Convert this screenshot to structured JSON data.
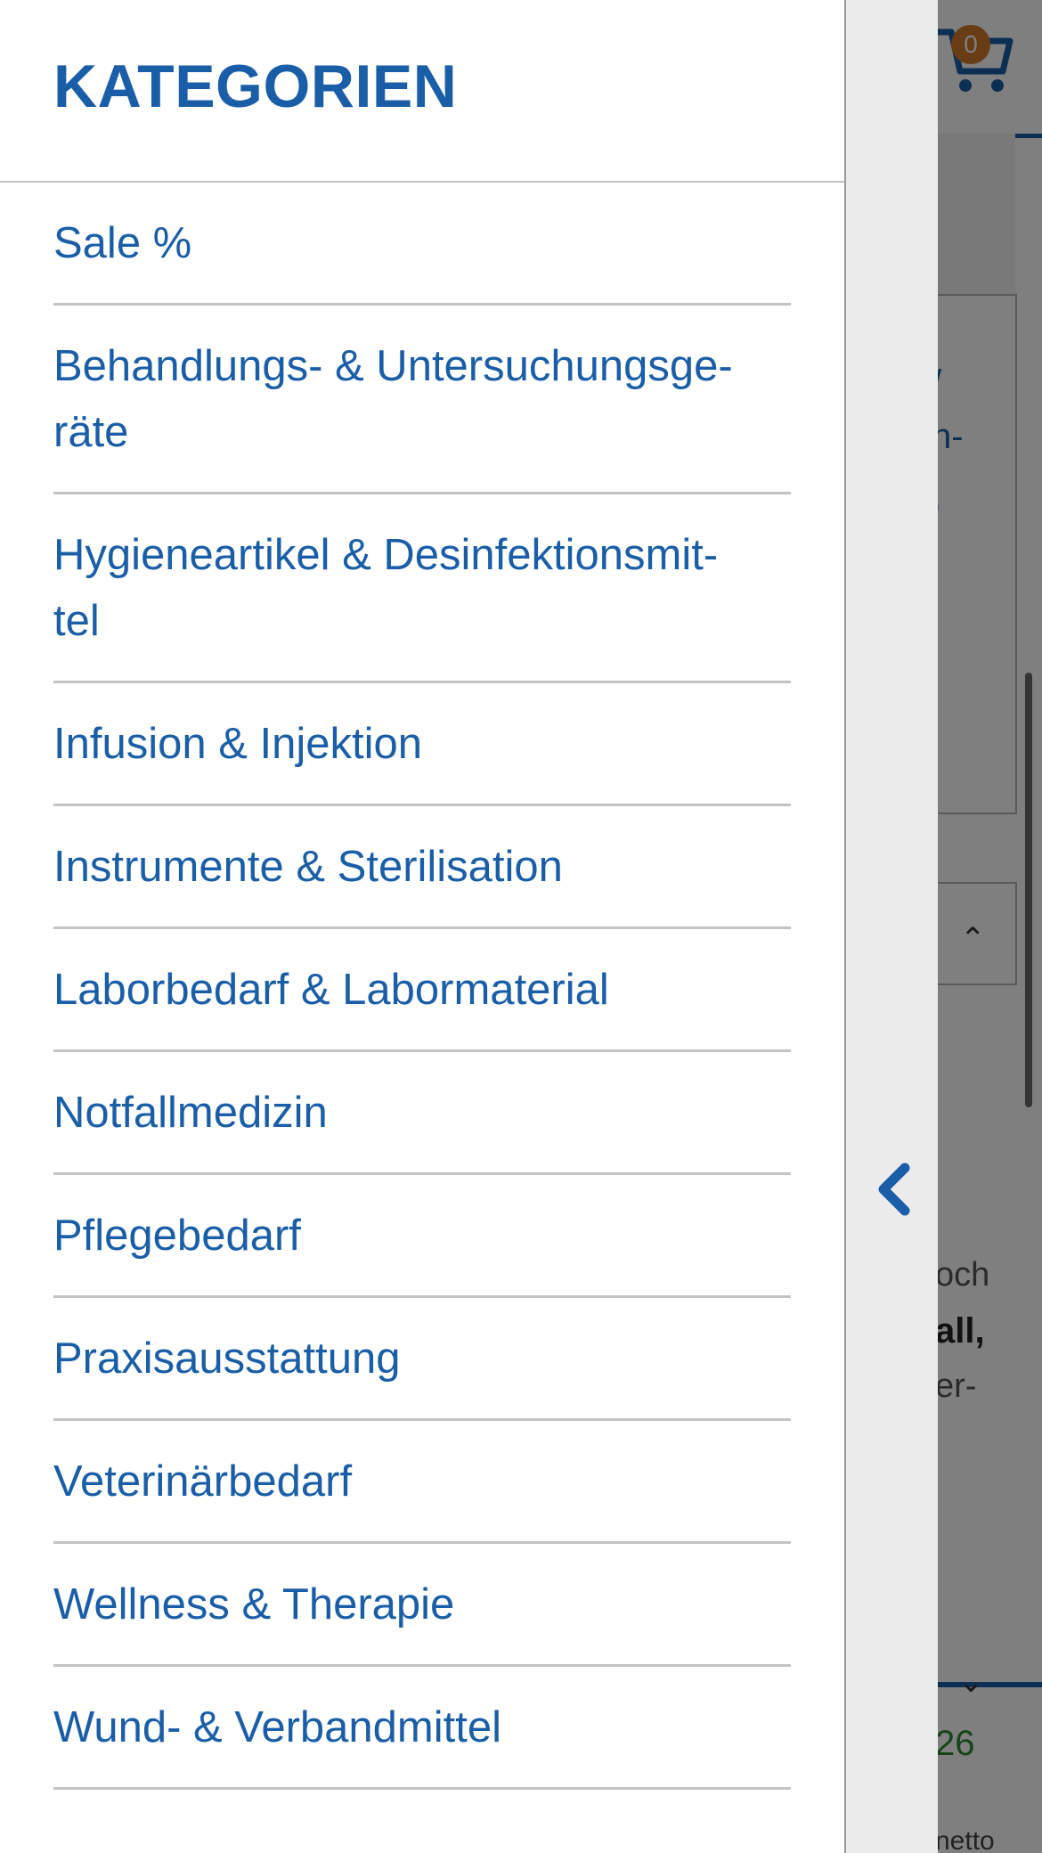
{
  "background": {
    "cart_count": "0",
    "link_fragments": [
      "/",
      "n-",
      ","
    ],
    "text_fragments": [
      "och",
      "all,",
      "er-"
    ],
    "price_fragment": "26",
    "netto_fragment": "netto"
  },
  "drawer": {
    "title": "KATEGORIEN",
    "categories": [
      {
        "label_lines": [
          "Sale %"
        ]
      },
      {
        "label_lines": [
          "Behandlungs- & Untersuchungsge-",
          "räte"
        ]
      },
      {
        "label_lines": [
          "Hygieneartikel & Desinfektionsmit-",
          "tel"
        ]
      },
      {
        "label_lines": [
          "Infusion & Injektion"
        ]
      },
      {
        "label_lines": [
          "Instrumente & Sterilisation"
        ]
      },
      {
        "label_lines": [
          "Laborbedarf & Labormaterial"
        ]
      },
      {
        "label_lines": [
          "Notfallmedizin"
        ]
      },
      {
        "label_lines": [
          "Pflegebedarf"
        ]
      },
      {
        "label_lines": [
          "Praxisausstattung"
        ]
      },
      {
        "label_lines": [
          "Veterinärbedarf"
        ]
      },
      {
        "label_lines": [
          "Wellness & Therapie"
        ]
      },
      {
        "label_lines": [
          "Wund- & Verbandmittel"
        ]
      }
    ],
    "back_icon": "chevron-left-icon"
  },
  "colors": {
    "accent": "#1a5ea8",
    "cart_badge": "#d0782a",
    "price_green": "#2e8b2e"
  }
}
